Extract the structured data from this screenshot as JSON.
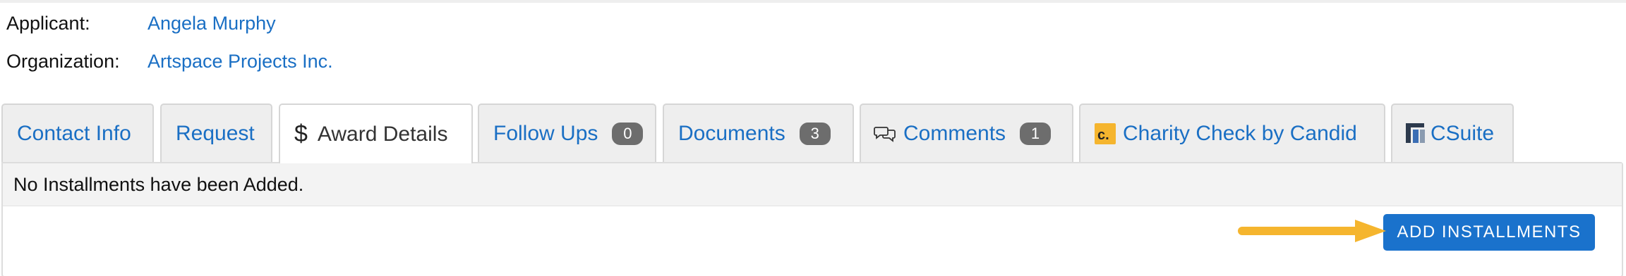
{
  "applicant": {
    "label": "Applicant:",
    "value": "Angela Murphy"
  },
  "organization": {
    "label": "Organization:",
    "value": "Artspace Projects Inc."
  },
  "tabs": [
    {
      "label": "Contact Info"
    },
    {
      "label": "Request"
    },
    {
      "label": "Award Details",
      "icon": "dollar-icon",
      "active": true
    },
    {
      "label": "Follow Ups",
      "badge": "0"
    },
    {
      "label": "Documents",
      "badge": "3"
    },
    {
      "label": "Comments",
      "badge": "1",
      "icon": "comments-icon"
    },
    {
      "label": "Charity Check by Candid",
      "icon": "candid-logo-icon"
    },
    {
      "label": "CSuite",
      "icon": "csuite-logo-icon"
    }
  ],
  "panel": {
    "message": "No Installments have been Added.",
    "add_button_label": "ADD INSTALLMENTS"
  },
  "colors": {
    "link": "#1a6fc4",
    "button": "#1a72cc",
    "arrow": "#f5b52e",
    "badge": "#6d6d6d"
  }
}
